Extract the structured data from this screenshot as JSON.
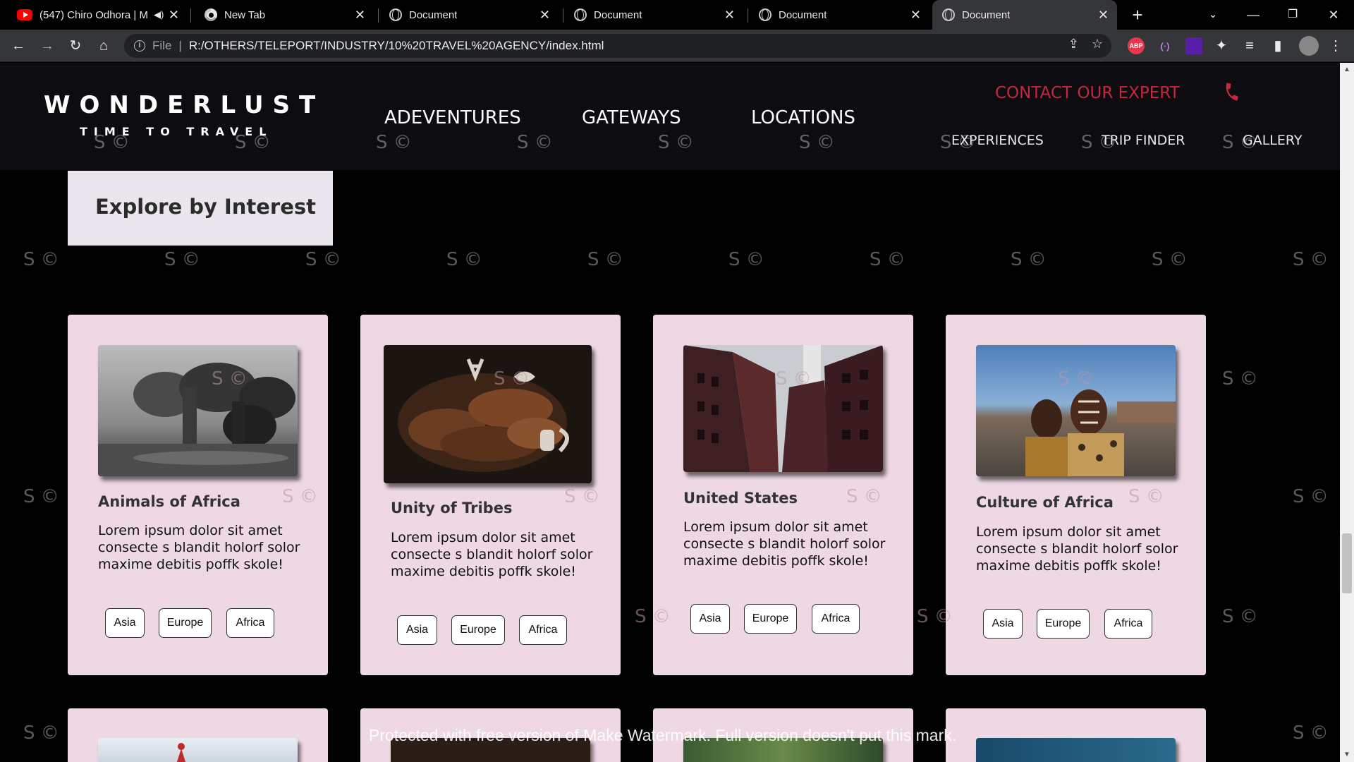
{
  "browser": {
    "tabs": [
      {
        "title": "(547) Chiro Odhora | M",
        "icon": "youtube-icon",
        "audio": true
      },
      {
        "title": "New Tab",
        "icon": "chrome-icon"
      },
      {
        "title": "Document",
        "icon": "globe-icon"
      },
      {
        "title": "Document",
        "icon": "globe-icon"
      },
      {
        "title": "Document",
        "icon": "globe-icon"
      },
      {
        "title": "Document",
        "icon": "globe-icon",
        "active": true
      }
    ],
    "address": {
      "scheme": "File",
      "url": "R:/OTHERS/TELEPORT/INDUSTRY/10%20TRAVEL%20AGENCY/index.html"
    },
    "extensions": [
      {
        "name": "adblock-icon",
        "label": "ABP",
        "color": "#e53950"
      },
      {
        "name": "radio-extension-icon",
        "label": "(·)",
        "color": "#a060e0"
      },
      {
        "name": "purple-extension-icon",
        "label": "",
        "color": "#5a1fa8"
      }
    ]
  },
  "header": {
    "logo": "WONDERLUST",
    "tagline": "TIME TO TRAVEL",
    "nav_main": [
      "ADEVENTURES",
      "GATEWAYS",
      "LOCATIONS"
    ],
    "contact": "CONTACT OUR EXPERT",
    "nav_sub": [
      "EXPERIENCES",
      "TRIP FINDER",
      "GALLERY"
    ],
    "accent_color": "#c4273f"
  },
  "section": {
    "title": "Explore by Interest"
  },
  "cards": [
    {
      "title": "Animals of Africa",
      "text": "Lorem ipsum dolor sit amet consecte s blandit holorf solor maxime debitis poffk skole!",
      "tags": [
        "Asia",
        "Europe",
        "Africa"
      ]
    },
    {
      "title": "Unity of Tribes",
      "text": "Lorem ipsum dolor sit amet consecte s blandit holorf solor maxime debitis poffk skole!",
      "tags": [
        "Asia",
        "Europe",
        "Africa"
      ]
    },
    {
      "title": "United States",
      "text": "Lorem ipsum dolor sit amet consecte s blandit holorf solor maxime debitis poffk skole!",
      "tags": [
        "Asia",
        "Europe",
        "Africa"
      ]
    },
    {
      "title": "Culture of Africa",
      "text": "Lorem ipsum dolor sit amet consecte s blandit holorf solor maxime debitis poffk skole!",
      "tags": [
        "Asia",
        "Europe",
        "Africa"
      ]
    }
  ],
  "watermark": {
    "mark": "S ©",
    "banner": "Protected with free version of Make Watermark. Full version doesn't put this mark."
  },
  "colors": {
    "card_bg": "#eed8e4",
    "interest_bg": "#ebe6ed",
    "header_bg": "#0d0d11"
  }
}
